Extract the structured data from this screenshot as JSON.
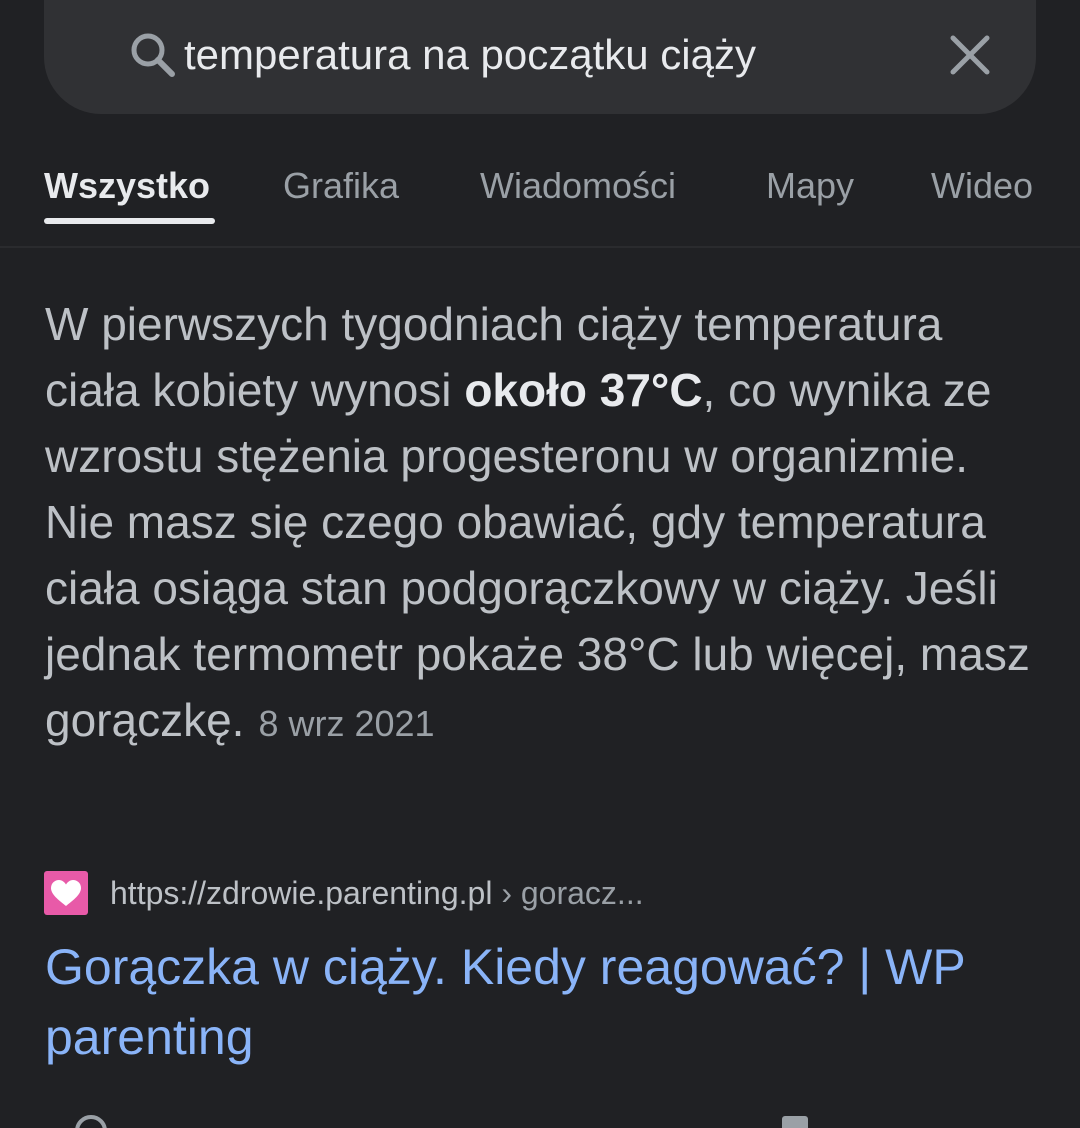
{
  "search": {
    "query": "temperatura na początku ciąży"
  },
  "tabs": [
    {
      "label": "Wszystko",
      "active": true
    },
    {
      "label": "Grafika",
      "active": false
    },
    {
      "label": "Wiadomości",
      "active": false
    },
    {
      "label": "Mapy",
      "active": false
    },
    {
      "label": "Wideo",
      "active": false
    }
  ],
  "featured_snippet": {
    "text_before_bold": "W pierwszych tygodniach ciąży temperatura ciała kobiety wynosi ",
    "bold_text": "około 37°C",
    "text_after_bold": ", co wynika ze wzrostu stężenia progesteronu w organizmie. Nie masz się czego obawiać, gdy temperatura ciała osiąga stan podgorączkowy w ciąży. Jeśli jednak termometr pokaże 38°C lub więcej, masz gorączkę.",
    "date": "8 wrz 2021"
  },
  "result": {
    "url": "https://zdrowie.parenting.pl",
    "breadcrumb": " › goracz...",
    "title": "Gorączka w ciąży. Kiedy reagować? | WP parenting"
  },
  "colors": {
    "background": "#202124",
    "search_bar": "#303134",
    "link": "#8ab4f8",
    "favicon": "#e85aa8"
  }
}
